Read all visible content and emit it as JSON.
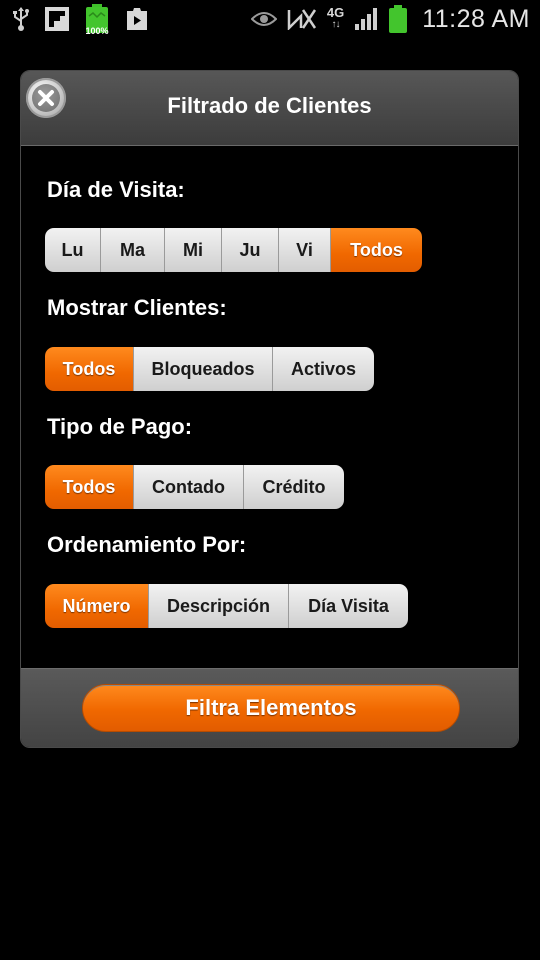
{
  "status_bar": {
    "battery_percent": "100%",
    "network": "4G",
    "time": "11:28 AM"
  },
  "dialog": {
    "title": "Filtrado de Clientes",
    "sections": [
      {
        "label": "Día de Visita:",
        "options": [
          "Lu",
          "Ma",
          "Mi",
          "Ju",
          "Vi",
          "Todos"
        ],
        "selected": "Todos"
      },
      {
        "label": "Mostrar Clientes:",
        "options": [
          "Todos",
          "Bloqueados",
          "Activos"
        ],
        "selected": "Todos"
      },
      {
        "label": "Tipo de Pago:",
        "options": [
          "Todos",
          "Contado",
          "Crédito"
        ],
        "selected": "Todos"
      },
      {
        "label": "Ordenamiento Por:",
        "options": [
          "Número",
          "Descripción",
          "Día Visita"
        ],
        "selected": "Número"
      }
    ],
    "submit_label": "Filtra Elementos"
  },
  "colors": {
    "accent": "#f06800",
    "segment_inactive": "#dcdcdc",
    "header": "#4a4a4a",
    "background": "#000000"
  }
}
